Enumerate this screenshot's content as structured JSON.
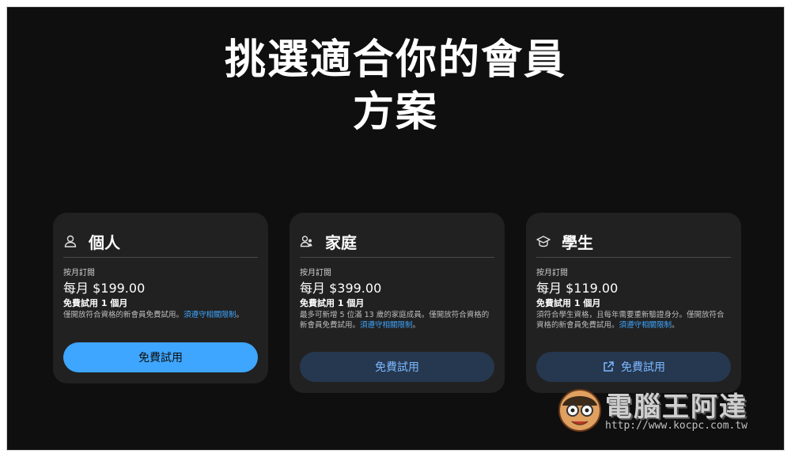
{
  "header": {
    "title_line1": "挑選適合你的會員",
    "title_line2": "方案"
  },
  "plans": [
    {
      "name": "個人",
      "icon": "person-icon",
      "period": "按月訂閱",
      "price": "每月 $199.00",
      "trial": "免費試用 1 個月",
      "note": "僅開放符合資格的新會員免費試用。",
      "link": "須遵守相關限制",
      "note_end": "。",
      "cta": "免費試用",
      "cta_style": "primary"
    },
    {
      "name": "家庭",
      "icon": "family-icon",
      "period": "按月訂閱",
      "price": "每月 $399.00",
      "trial": "免費試用 1 個月",
      "note": "最多可新增 5 位滿 13 歲的家庭成員。僅開放符合資格的新會員免費試用。",
      "link": "須遵守相關限制",
      "note_end": "。",
      "cta": "免費試用",
      "cta_style": "secondary"
    },
    {
      "name": "學生",
      "icon": "graduation-cap-icon",
      "period": "按月訂閱",
      "price": "每月 $119.00",
      "trial": "免費試用 1 個月",
      "note": "須符合學生資格，且每年需要重新驗證身分。僅開放符合資格的新會員免費試用。",
      "link": "須遵守相關限制",
      "note_end": "。",
      "cta": "免費試用",
      "cta_style": "secondary",
      "cta_icon": "external-link-icon"
    }
  ],
  "watermark": {
    "brand": "電腦王阿達",
    "url": "http://www.kocpc.com.tw"
  },
  "colors": {
    "background": "#0f0f0f",
    "card": "#212121",
    "accent": "#3ea6ff",
    "secondary_button": "#263850"
  }
}
